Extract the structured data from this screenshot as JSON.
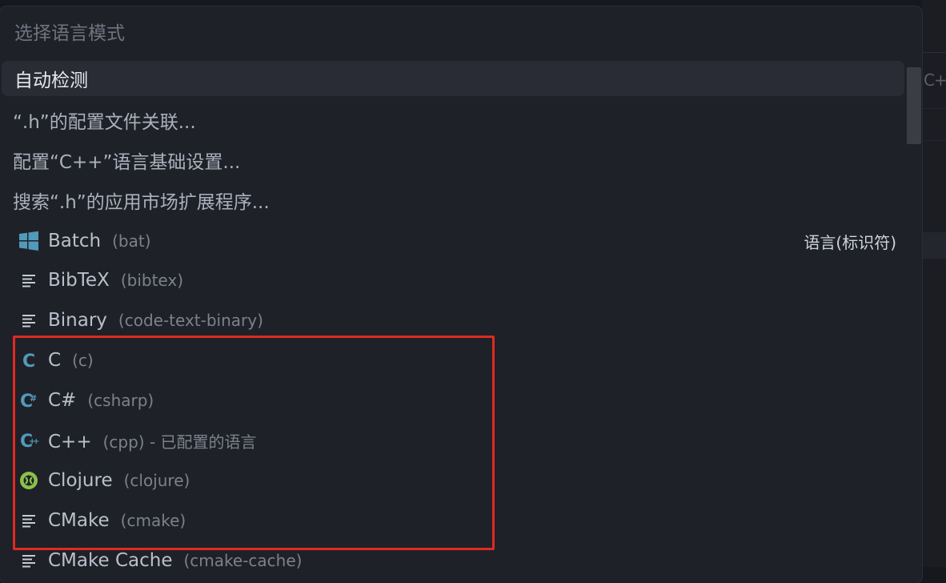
{
  "title": "选择语言模式",
  "actions": [
    {
      "label": "自动检测"
    },
    {
      "label": "“.h”的配置文件关联..."
    },
    {
      "label": "配置“C++”语言基础设置..."
    },
    {
      "label": "搜索“.h”的应用市场扩展程序..."
    }
  ],
  "languages": [
    {
      "label": "Batch",
      "id": "(bat)",
      "icon": "windows-icon"
    },
    {
      "label": "BibTeX",
      "id": "(bibtex)",
      "icon": "file-lines-icon"
    },
    {
      "label": "Binary",
      "id": "(code-text-binary)",
      "icon": "file-lines-icon"
    },
    {
      "label": "C",
      "id": "(c)",
      "icon": "c-language-icon"
    },
    {
      "label": "C#",
      "id": "(csharp)",
      "icon": "csharp-language-icon"
    },
    {
      "label": "C++",
      "id": "(cpp) - 已配置的语言",
      "icon": "cpp-language-icon"
    },
    {
      "label": "Clojure",
      "id": "(clojure)",
      "icon": "clojure-icon"
    },
    {
      "label": "CMake",
      "id": "(cmake)",
      "icon": "file-lines-icon"
    },
    {
      "label": "CMake Cache",
      "id": "(cmake-cache)",
      "icon": "file-lines-icon"
    }
  ],
  "section_label": "语言(标识符)",
  "background_tab_text": "C++",
  "colors": {
    "accent_blue": "#519aba",
    "clojure_green": "#8dc149",
    "highlight_red": "#e02a20"
  }
}
